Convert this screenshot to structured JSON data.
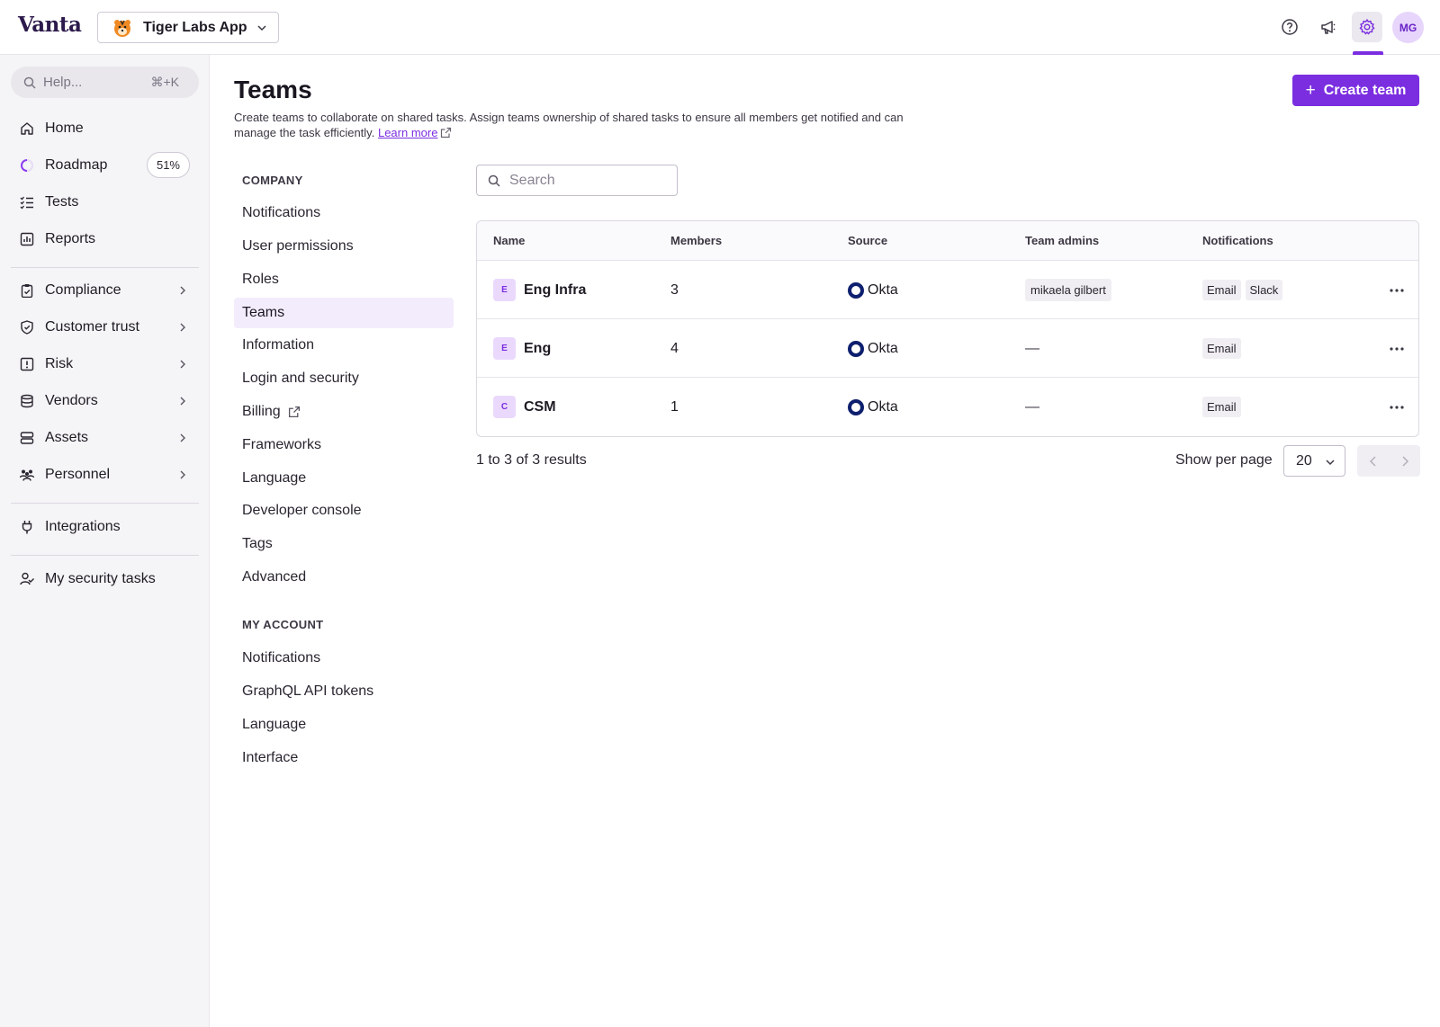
{
  "app": {
    "logo": "Vanta",
    "workspace": "Tiger Labs App",
    "avatar_initials": "MG"
  },
  "colors": {
    "accent": "#7b2ee0",
    "okta": "#0d1f6e"
  },
  "topbar_icons": [
    "help-circle-icon",
    "megaphone-icon",
    "gear-icon"
  ],
  "sidebar": {
    "search_placeholder": "Help...",
    "search_shortcut": "⌘+K",
    "items": [
      {
        "label": "Home",
        "icon": "home-icon"
      },
      {
        "label": "Roadmap",
        "icon": "progress-ring-icon",
        "badge": "51%"
      },
      {
        "label": "Tests",
        "icon": "checklist-icon"
      },
      {
        "label": "Reports",
        "icon": "bar-chart-icon"
      },
      {
        "label": "Compliance",
        "icon": "clipboard-check-icon"
      },
      {
        "label": "Customer trust",
        "icon": "shield-check-icon"
      },
      {
        "label": "Risk",
        "icon": "alert-square-icon"
      },
      {
        "label": "Vendors",
        "icon": "database-icon"
      },
      {
        "label": "Assets",
        "icon": "server-icon"
      },
      {
        "label": "Personnel",
        "icon": "people-icon"
      },
      {
        "label": "Integrations",
        "icon": "plug-icon"
      },
      {
        "label": "My security tasks",
        "icon": "user-check-icon"
      }
    ]
  },
  "main": {
    "title": "Teams",
    "description": "Create teams to collaborate on shared tasks. Assign teams ownership of shared tasks to ensure all members get notified and can manage the task efficiently.",
    "learn_more": "Learn more",
    "create_button": "Create team",
    "search_placeholder": "Search"
  },
  "settings_nav": {
    "company_heading": "COMPANY",
    "company_items": [
      "Notifications",
      "User permissions",
      "Roles",
      "Teams",
      "Information",
      "Login and security",
      "Billing",
      "Frameworks",
      "Language",
      "Developer console",
      "Tags",
      "Advanced"
    ],
    "account_heading": "MY ACCOUNT",
    "account_items": [
      "Notifications",
      "GraphQL API tokens",
      "Language",
      "Interface"
    ],
    "active": "Teams"
  },
  "table": {
    "columns": [
      "Name",
      "Members",
      "Source",
      "Team admins",
      "Notifications"
    ],
    "rows": [
      {
        "initial": "E",
        "name": "Eng Infra",
        "members": "3",
        "source": "Okta",
        "admins": "mikaela gilbert",
        "notif_1": "Email",
        "notif_2": "Slack"
      },
      {
        "initial": "E",
        "name": "Eng",
        "members": "4",
        "source": "Okta",
        "admins": "—",
        "notif_1": "Email"
      },
      {
        "initial": "C",
        "name": "CSM",
        "members": "1",
        "source": "Okta",
        "admins": "—",
        "notif_1": "Email"
      }
    ]
  },
  "pagination": {
    "results": "1 to 3 of 3 results",
    "per_page_label": "Show per page",
    "per_page": "20"
  }
}
